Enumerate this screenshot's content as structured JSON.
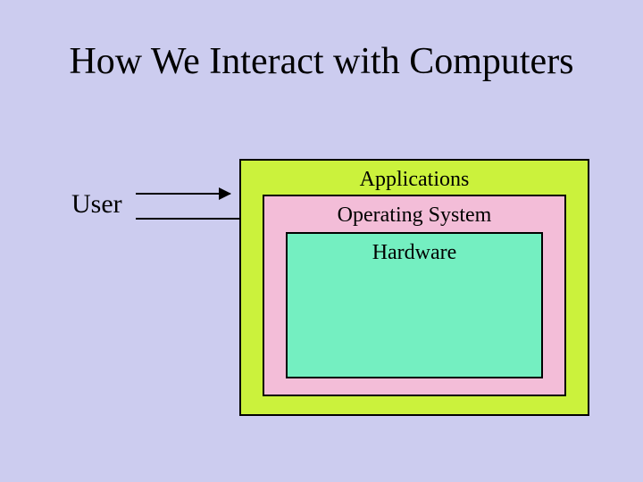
{
  "title": "How We Interact with Computers",
  "user_label": "User",
  "layers": {
    "outer": "Applications",
    "mid": "Operating System",
    "inner": "Hardware"
  },
  "colors": {
    "background": "#ccccef",
    "outer_box": "#cbf23c",
    "mid_box": "#f3bdd8",
    "inner_box": "#74efc1",
    "border": "#000000"
  }
}
